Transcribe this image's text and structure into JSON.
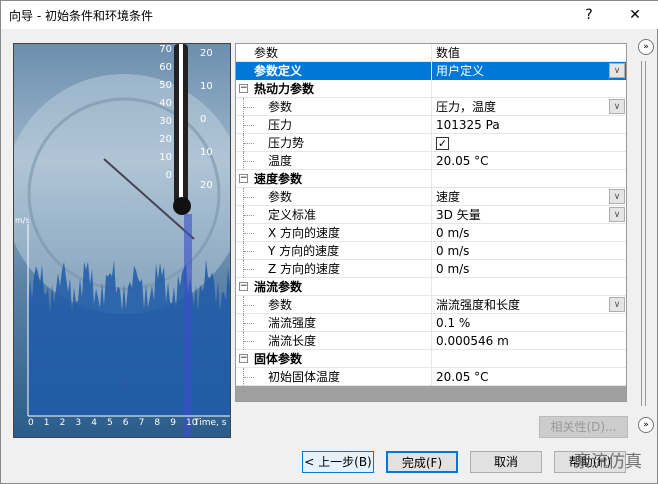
{
  "window": {
    "title": "向导 - 初始条件和环境条件",
    "help": "?",
    "close": "✕"
  },
  "picture": {
    "y_unit": "m/s",
    "x_label": "Time, s",
    "thermo_ticks": [
      "70",
      "60",
      "50",
      "40",
      "30",
      "20",
      "10",
      "0"
    ],
    "thermo_ticks_right": [
      "20",
      "10",
      "0",
      "10",
      "20"
    ],
    "x_ticks": [
      "0",
      "1",
      "2",
      "3",
      "4",
      "5",
      "6",
      "7",
      "8",
      "9",
      "10"
    ]
  },
  "grid": {
    "header": {
      "param": "参数",
      "value": "数值"
    },
    "rows": [
      {
        "type": "sel",
        "label": "参数定义",
        "value": "用户定义",
        "dropdown": true
      },
      {
        "type": "cat",
        "label": "热动力参数"
      },
      {
        "type": "sub",
        "label": "参数",
        "value": "压力，温度",
        "dropdown": true
      },
      {
        "type": "sub",
        "label": "压力",
        "value": "101325 Pa"
      },
      {
        "type": "sub",
        "label": "压力势",
        "value": "✓",
        "checkbox": true
      },
      {
        "type": "sub",
        "label": "温度",
        "value": "20.05 °C"
      },
      {
        "type": "cat",
        "label": "速度参数"
      },
      {
        "type": "sub",
        "label": "参数",
        "value": "速度",
        "dropdown": true
      },
      {
        "type": "sub",
        "label": "定义标准",
        "value": "3D 矢量",
        "dropdown": true
      },
      {
        "type": "sub",
        "label": "X 方向的速度",
        "value": "0 m/s"
      },
      {
        "type": "sub",
        "label": "Y 方向的速度",
        "value": "0 m/s"
      },
      {
        "type": "sub",
        "label": "Z 方向的速度",
        "value": "0 m/s"
      },
      {
        "type": "cat",
        "label": "湍流参数"
      },
      {
        "type": "sub",
        "label": "参数",
        "value": "湍流强度和长度",
        "dropdown": true
      },
      {
        "type": "sub",
        "label": "湍流强度",
        "value": "0.1 %"
      },
      {
        "type": "sub",
        "label": "湍流长度",
        "value": "0.000546 m"
      },
      {
        "type": "cat",
        "label": "固体参数"
      },
      {
        "type": "sub",
        "label": "初始固体温度",
        "value": "20.05 °C"
      }
    ]
  },
  "buttons": {
    "dependency": "相关性(D)...",
    "back": "< 上一步(B)",
    "finish": "完成(F)",
    "cancel": "取消",
    "help": "帮助(H)",
    "expand": "»"
  },
  "watermark": "紊流仿真"
}
